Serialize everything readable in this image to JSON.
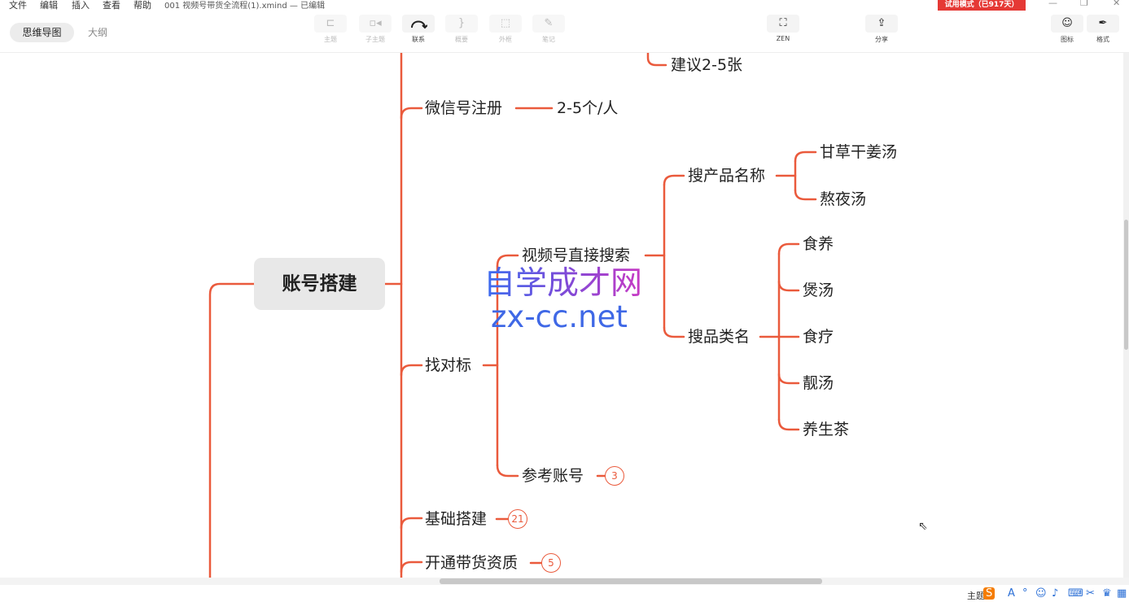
{
  "menu": [
    "文件",
    "编辑",
    "插入",
    "查看",
    "帮助"
  ],
  "document_title": "001 视频号带货全流程(1).xmind — 已编辑",
  "trial_badge": "试用模式（已917天）",
  "view_tabs": {
    "mindmap": "思维导图",
    "outline": "大纲"
  },
  "toolbar": {
    "topic": "主题",
    "subtopic": "子主题",
    "relationship": "联系",
    "summary": "概要",
    "boundary": "外框",
    "note": "笔记",
    "zen": "ZEN",
    "share": "分享",
    "icon": "图标",
    "format": "格式"
  },
  "mindmap": {
    "central": "账号搭建",
    "nodes": {
      "suggest": "建议2-5张",
      "wechat": "微信号注册",
      "wechat_child": "2-5个/人",
      "benchmark": "找对标",
      "direct_search": "视频号直接搜索",
      "product_name": "搜产品名称",
      "gancao": "甘草干姜汤",
      "aoye": "熬夜汤",
      "category": "搜品类名",
      "shiyang": "食养",
      "baotang": "煲汤",
      "shiliao": "食疗",
      "liangtang": "靓汤",
      "yangsheng": "养生茶",
      "reference": "参考账号",
      "basic": "基础搭建",
      "commerce": "开通带货资质"
    },
    "badges": {
      "reference": "3",
      "basic": "21",
      "commerce": "5"
    }
  },
  "watermark": {
    "cn": "自学成才网",
    "url": "zx-cc.net"
  },
  "status": {
    "label": "主题"
  },
  "colors": {
    "branch": "#ea5a3c",
    "central_bg": "#e8e8e8",
    "trial": "#e53935"
  }
}
